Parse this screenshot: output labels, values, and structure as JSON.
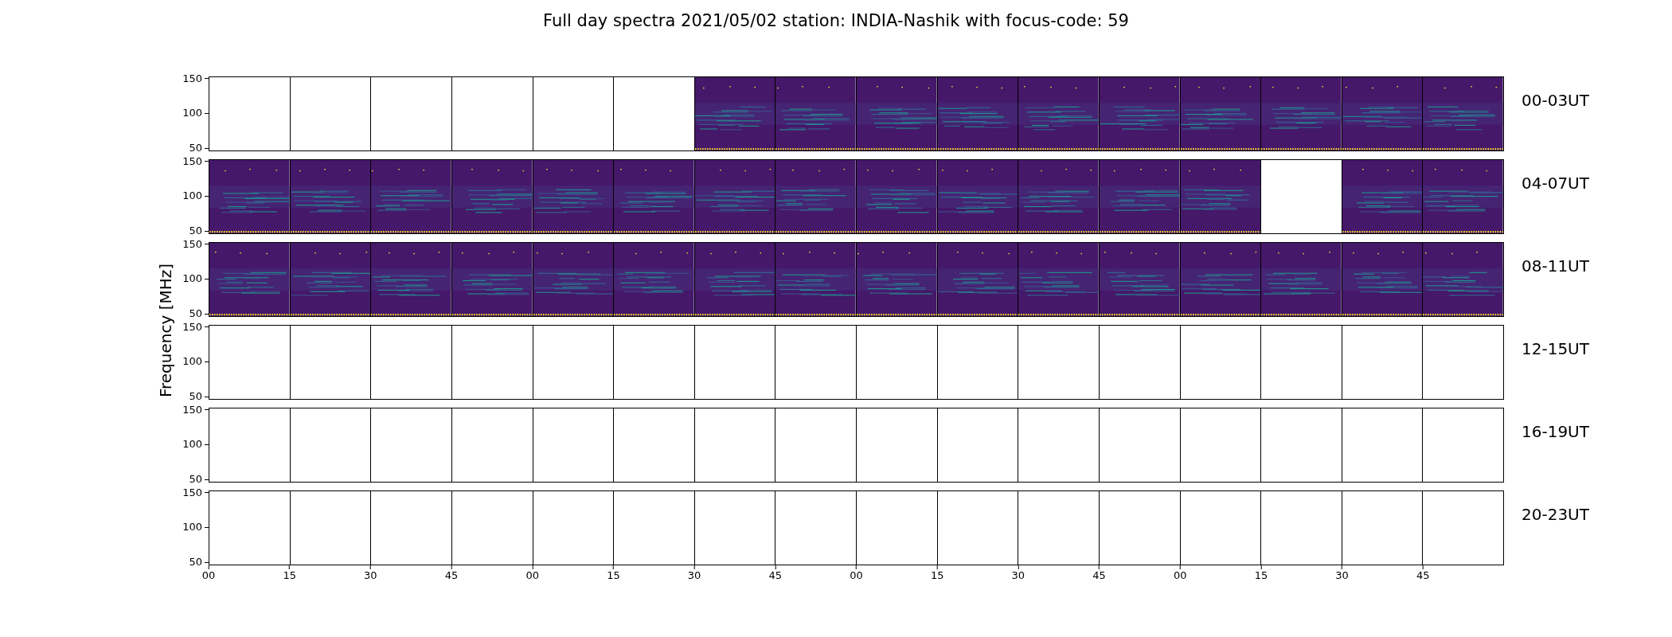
{
  "title": "Full day spectra 2021/05/02 station: INDIA-Nashik with focus-code: 59",
  "ylabel": "Frequency [MHz]",
  "rows": [
    {
      "label": "00-03UT",
      "yticks": [
        "150",
        "100",
        "50"
      ],
      "panels": [
        false,
        false,
        false,
        false,
        false,
        false,
        true,
        true,
        true,
        true,
        true,
        true,
        true,
        true,
        true,
        true
      ]
    },
    {
      "label": "04-07UT",
      "yticks": [
        "150",
        "100",
        "50"
      ],
      "panels": [
        true,
        true,
        true,
        true,
        true,
        true,
        true,
        true,
        true,
        true,
        true,
        true,
        true,
        false,
        true,
        true
      ]
    },
    {
      "label": "08-11UT",
      "yticks": [
        "150",
        "100",
        "50"
      ],
      "panels": [
        true,
        true,
        true,
        true,
        true,
        true,
        true,
        true,
        true,
        true,
        true,
        true,
        true,
        true,
        true,
        true
      ]
    },
    {
      "label": "12-15UT",
      "yticks": [
        "150",
        "100",
        "50"
      ],
      "panels": [
        false,
        false,
        false,
        false,
        false,
        false,
        false,
        false,
        false,
        false,
        false,
        false,
        false,
        false,
        false,
        false
      ]
    },
    {
      "label": "16-19UT",
      "yticks": [
        "150",
        "100",
        "50"
      ],
      "panels": [
        false,
        false,
        false,
        false,
        false,
        false,
        false,
        false,
        false,
        false,
        false,
        false,
        false,
        false,
        false,
        false
      ]
    },
    {
      "label": "20-23UT",
      "yticks": [
        "150",
        "100",
        "50"
      ],
      "panels": [
        false,
        false,
        false,
        false,
        false,
        false,
        false,
        false,
        false,
        false,
        false,
        false,
        false,
        false,
        false,
        false
      ]
    }
  ],
  "xticks": [
    "00",
    "15",
    "30",
    "45",
    "00",
    "15",
    "30",
    "45",
    "00",
    "15",
    "30",
    "45",
    "00",
    "15",
    "30",
    "45"
  ]
}
